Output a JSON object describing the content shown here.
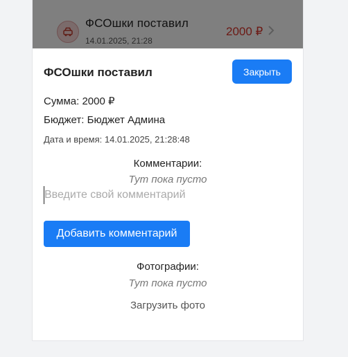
{
  "background_item": {
    "title": "ФСОшки поставил",
    "datetime": "14.01.2025, 21:28",
    "amount": "2000 ₽"
  },
  "modal": {
    "title": "ФСОшки поставил",
    "close_label": "Закрыть",
    "sum_text": "Сумма: 2000 ₽",
    "budget_text": "Бюджет: Бюджет Админа",
    "datetime_text": "Дата и время: 14.01.2025, 21:28:48",
    "comments": {
      "heading": "Комментарии:",
      "empty_text": "Тут пока пусто",
      "input_placeholder": "Введите свой комментарий",
      "input_value": "",
      "add_label": "Добавить комментарий"
    },
    "photos": {
      "heading": "Фотографии:",
      "empty_text": "Тут пока пусто",
      "upload_label": "Загрузить фото"
    }
  },
  "colors": {
    "accent": "#1a7cf5",
    "amount_negative": "#d9342b",
    "overlay": "rgba(0,0,0,0.5)"
  }
}
